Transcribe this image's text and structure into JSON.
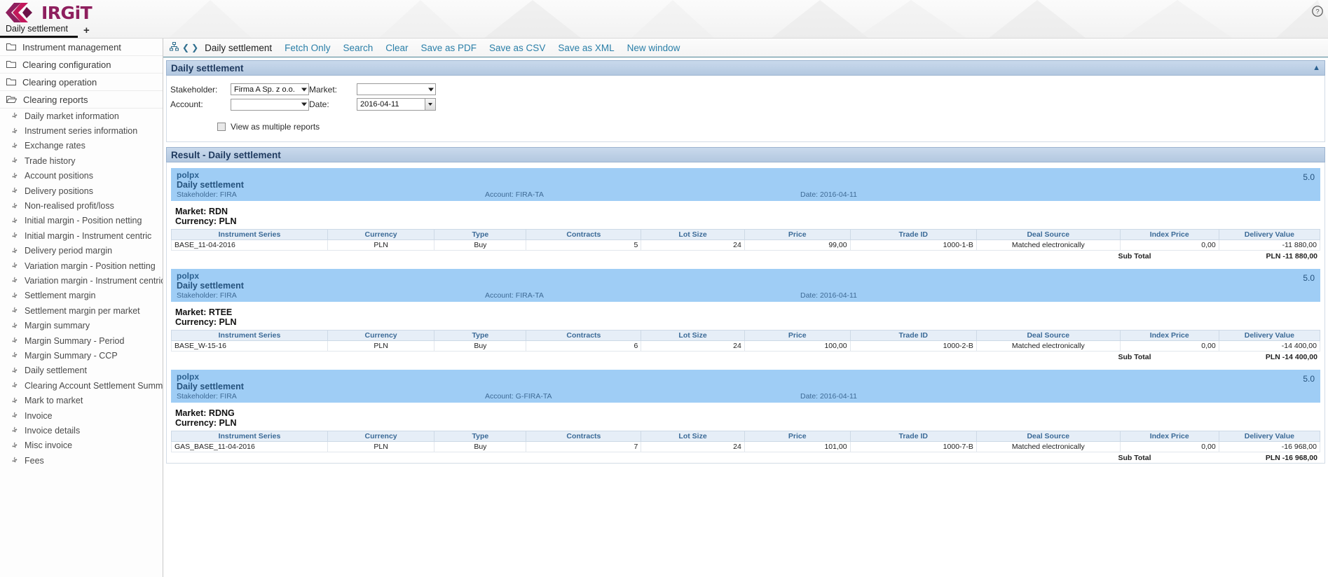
{
  "header": {
    "logo_text": "IRGiT",
    "logo_icon": "irgit-logo-icon",
    "help_icon": "help-circle-icon",
    "tab_label": "Daily settlement",
    "add_tab_label": "+"
  },
  "sidebar": {
    "folders": [
      {
        "label": "Instrument management",
        "icon": "folder-closed-icon"
      },
      {
        "label": "Clearing configuration",
        "icon": "folder-closed-icon"
      },
      {
        "label": "Clearing operation",
        "icon": "folder-closed-icon"
      },
      {
        "label": "Clearing reports",
        "icon": "folder-open-icon"
      }
    ],
    "items": [
      {
        "label": "Daily market information"
      },
      {
        "label": "Instrument series information"
      },
      {
        "label": "Exchange rates"
      },
      {
        "label": "Trade history"
      },
      {
        "label": "Account positions"
      },
      {
        "label": "Delivery positions"
      },
      {
        "label": "Non-realised profit/loss"
      },
      {
        "label": "Initial margin - Position netting"
      },
      {
        "label": "Initial margin - Instrument centric"
      },
      {
        "label": "Delivery period margin"
      },
      {
        "label": "Variation margin - Position netting"
      },
      {
        "label": "Variation margin - Instrument centric"
      },
      {
        "label": "Settlement margin"
      },
      {
        "label": "Settlement margin per market"
      },
      {
        "label": "Margin summary"
      },
      {
        "label": "Margin Summary - Period"
      },
      {
        "label": "Margin Summary - CCP"
      },
      {
        "label": "Daily settlement"
      },
      {
        "label": "Clearing Account Settlement Summary"
      },
      {
        "label": "Mark to market"
      },
      {
        "label": "Invoice"
      },
      {
        "label": "Invoice details"
      },
      {
        "label": "Misc invoice"
      },
      {
        "label": "Fees"
      }
    ]
  },
  "toolbar": {
    "home_icon": "sitemap-icon",
    "prev_icon": "chevron-left-icon",
    "next_icon": "chevron-right-icon",
    "title": "Daily settlement",
    "links": [
      "Fetch Only",
      "Search",
      "Clear",
      "Save as PDF",
      "Save as CSV",
      "Save as XML",
      "New window"
    ]
  },
  "search_panel": {
    "title": "Daily settlement",
    "collapse_icon": "collapse-icon",
    "stakeholder_label": "Stakeholder:",
    "stakeholder_value": "Firma A Sp. z o.o.",
    "account_label": "Account:",
    "account_value": "",
    "market_label": "Market:",
    "market_value": "",
    "date_label": "Date:",
    "date_value": "2016-04-11",
    "date_picker_icon": "calendar-dropdown-icon",
    "multiple_reports_label": "View as multiple reports",
    "multiple_reports_checked": false
  },
  "result_panel": {
    "title": "Result - Daily settlement",
    "columns": [
      "Instrument Series",
      "Currency",
      "Type",
      "Contracts",
      "Lot Size",
      "Price",
      "Trade ID",
      "Deal Source",
      "Index Price",
      "Delivery Value"
    ],
    "subtotal_label": "Sub Total",
    "reports": [
      {
        "org": "polpx",
        "name": "Daily settlement",
        "stakeholder": "Stakeholder: FIRA",
        "account": "Account: FIRA-TA",
        "date": "Date: 2016-04-11",
        "version": "5.0",
        "market_line": "Market: RDN",
        "currency_line": "Currency: PLN",
        "rows": [
          {
            "instrument_series": "BASE_11-04-2016",
            "currency": "PLN",
            "type": "Buy",
            "contracts": "5",
            "lot_size": "24",
            "price": "99,00",
            "trade_id": "1000-1-B",
            "deal_source": "Matched electronically",
            "index_price": "0,00",
            "delivery_value": "-11 880,00"
          }
        ],
        "subtotal_value": "PLN -11 880,00"
      },
      {
        "org": "polpx",
        "name": "Daily settlement",
        "stakeholder": "Stakeholder: FIRA",
        "account": "Account: FIRA-TA",
        "date": "Date: 2016-04-11",
        "version": "5.0",
        "market_line": "Market: RTEE",
        "currency_line": "Currency: PLN",
        "rows": [
          {
            "instrument_series": "BASE_W-15-16",
            "currency": "PLN",
            "type": "Buy",
            "contracts": "6",
            "lot_size": "24",
            "price": "100,00",
            "trade_id": "1000-2-B",
            "deal_source": "Matched electronically",
            "index_price": "0,00",
            "delivery_value": "-14 400,00"
          }
        ],
        "subtotal_value": "PLN -14 400,00"
      },
      {
        "org": "polpx",
        "name": "Daily settlement",
        "stakeholder": "Stakeholder: FIRA",
        "account": "Account: G-FIRA-TA",
        "date": "Date: 2016-04-11",
        "version": "5.0",
        "market_line": "Market: RDNG",
        "currency_line": "Currency: PLN",
        "rows": [
          {
            "instrument_series": "GAS_BASE_11-04-2016",
            "currency": "PLN",
            "type": "Buy",
            "contracts": "7",
            "lot_size": "24",
            "price": "101,00",
            "trade_id": "1000-7-B",
            "deal_source": "Matched electronically",
            "index_price": "0,00",
            "delivery_value": "-16 968,00"
          }
        ],
        "subtotal_value": "PLN -16 968,00"
      }
    ]
  },
  "colors": {
    "brand": "#8e1f5e",
    "link": "#2a7fa8",
    "panel_header": "#b3c8e0",
    "report_band": "#9fcdf5"
  }
}
